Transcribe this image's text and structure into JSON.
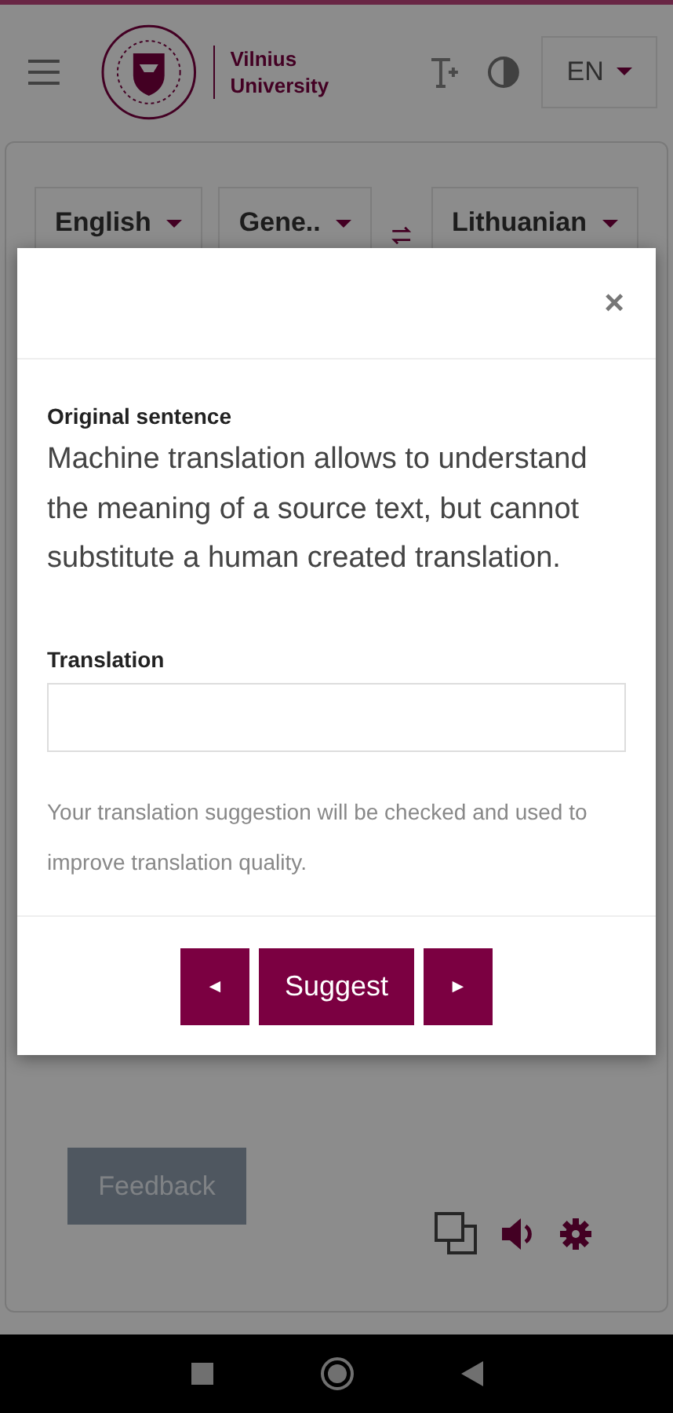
{
  "header": {
    "logo_text": "Vilnius University",
    "language": "EN"
  },
  "translator": {
    "source_language": "English",
    "domain": "Gene..",
    "target_language": "Lithuanian"
  },
  "modal": {
    "close": "×",
    "original_label": "Original sentence",
    "original_text": "Machine translation allows to understand the meaning of a source text, but cannot substitute a human created translation.",
    "translation_label": "Translation",
    "note": "Your translation suggestion will be checked and used to improve translation quality.",
    "prev": "◄",
    "suggest": "Suggest",
    "next": "►"
  },
  "feedback_button": "Feedback"
}
